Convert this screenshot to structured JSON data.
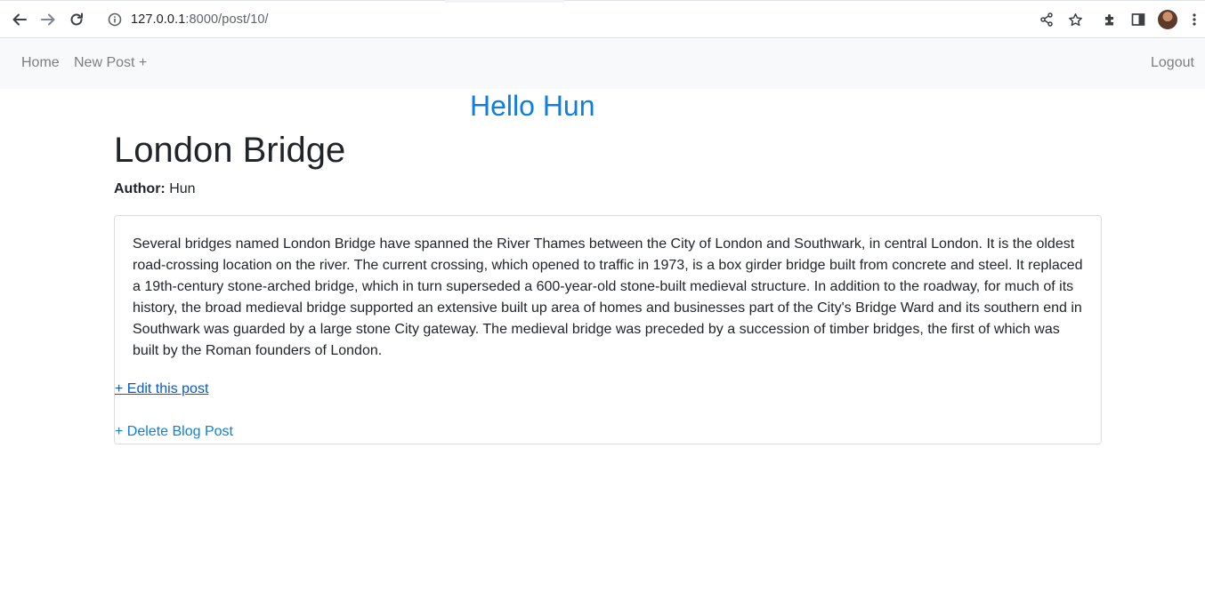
{
  "browser": {
    "url_host": "127.0.0.1",
    "url_rest": ":8000/post/10/"
  },
  "nav": {
    "home": "Home",
    "new_post": "New Post +",
    "logout": "Logout"
  },
  "greeting": "Hello Hun",
  "post": {
    "title": "London Bridge",
    "author_label": "Author:",
    "author": "Hun",
    "body": "Several bridges named London Bridge have spanned the River Thames between the City of London and Southwark, in central London. It is the oldest road-crossing location on the river. The current crossing, which opened to traffic in 1973, is a box girder bridge built from concrete and steel. It replaced a 19th-century stone-arched bridge, which in turn superseded a 600-year-old stone-built medieval structure. In addition to the roadway, for much of its history, the broad medieval bridge supported an extensive built up area of homes and businesses part of the City's Bridge Ward and its southern end in Southwark was guarded by a large stone City gateway. The medieval bridge was preceded by a succession of timber bridges, the first of which was built by the Roman founders of London.",
    "edit_link": "+ Edit this post",
    "delete_link": "+ Delete Blog Post"
  },
  "colors": {
    "accent": "#0d7fe3",
    "visited_link": "#0a58ca",
    "navbar_bg": "#f8f9fa",
    "nav_text": "#7a7f84"
  },
  "icons": [
    "back-arrow-icon",
    "forward-arrow-icon",
    "reload-icon",
    "site-info-icon",
    "share-icon",
    "bookmark-star-icon",
    "extensions-puzzle-icon",
    "side-panel-icon",
    "profile-avatar",
    "browser-menu-icon"
  ]
}
